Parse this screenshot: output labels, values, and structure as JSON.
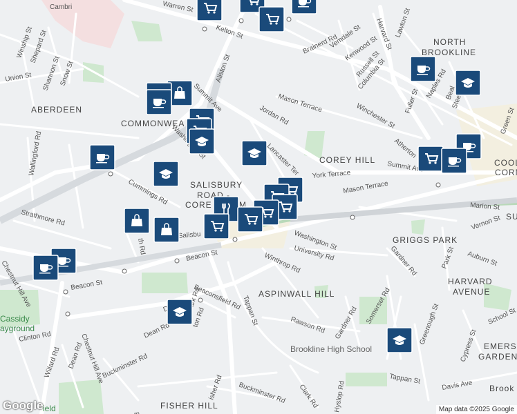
{
  "streets": [
    {
      "id": "cambridge",
      "text": "Cambri"
    },
    {
      "id": "warren",
      "text": "Warren St"
    },
    {
      "id": "kelton",
      "text": "Kelton St"
    },
    {
      "id": "brainerd",
      "text": "Brainerd Rd"
    },
    {
      "id": "vemdale",
      "text": "Vemdale St"
    },
    {
      "id": "kenwood",
      "text": "Kenwood St"
    },
    {
      "id": "harvard",
      "text": "Harvard St"
    },
    {
      "id": "lawton",
      "text": "Lawton St"
    },
    {
      "id": "russell",
      "text": "Russell St"
    },
    {
      "id": "columbia",
      "text": "Columbia St"
    },
    {
      "id": "winship",
      "text": "Winship St"
    },
    {
      "id": "shepard",
      "text": "Shepard St"
    },
    {
      "id": "union",
      "text": "Union St"
    },
    {
      "id": "shannon",
      "text": "Shannon St"
    },
    {
      "id": "snow",
      "text": "Snow St"
    },
    {
      "id": "allston",
      "text": "Allston St"
    },
    {
      "id": "summit1",
      "text": "Summit Ave"
    },
    {
      "id": "mason1",
      "text": "Mason Terrace"
    },
    {
      "id": "jordan",
      "text": "Jordan Rd"
    },
    {
      "id": "winchester",
      "text": "Winchester St"
    },
    {
      "id": "fuller",
      "text": "Fuller St"
    },
    {
      "id": "naples",
      "text": "Naples Rd"
    },
    {
      "id": "beals",
      "text": "Beal"
    },
    {
      "id": "steel",
      "text": "Stee"
    },
    {
      "id": "green",
      "text": "Green St"
    },
    {
      "id": "atherton",
      "text": "Atherton"
    },
    {
      "id": "washington1",
      "text": "Washington St"
    },
    {
      "id": "lancaster",
      "text": "Lancaster Ter"
    },
    {
      "id": "york",
      "text": "York Terrace"
    },
    {
      "id": "mason2",
      "text": "Mason Terrace"
    },
    {
      "id": "summit2",
      "text": "Summit Ave"
    },
    {
      "id": "wallingford",
      "text": "Wallingford Rd"
    },
    {
      "id": "cummings",
      "text": "Cummings Rd"
    },
    {
      "id": "kilsyth",
      "text": "th Rd"
    },
    {
      "id": "strathmore",
      "text": "Strathmore Rd"
    },
    {
      "id": "salisbury",
      "text": "Salisbu"
    },
    {
      "id": "washington2",
      "text": "Washington St"
    },
    {
      "id": "marion",
      "text": "Marion St"
    },
    {
      "id": "vernon",
      "text": "Vernon St"
    },
    {
      "id": "beacon1",
      "text": "Beacon St"
    },
    {
      "id": "beacon2",
      "text": "Beacon St"
    },
    {
      "id": "university",
      "text": "University Rd"
    },
    {
      "id": "winthrop",
      "text": "Winthrop Rd"
    },
    {
      "id": "gardner1",
      "text": "Gardner Rd"
    },
    {
      "id": "park",
      "text": "Park St"
    },
    {
      "id": "auburn",
      "text": "Auburn St"
    },
    {
      "id": "chestnut1",
      "text": "Chestnut Hill Ave"
    },
    {
      "id": "beaconsfield",
      "text": "Beaconsfield Rd"
    },
    {
      "id": "tappan1",
      "text": "Tappan St"
    },
    {
      "id": "rawson",
      "text": "Rawson Rd"
    },
    {
      "id": "gardner2",
      "text": "Gardner Rd"
    },
    {
      "id": "somerset",
      "text": "Somerset Rd"
    },
    {
      "id": "greenough",
      "text": "Greenough St"
    },
    {
      "id": "cypress",
      "text": "Cypress St"
    },
    {
      "id": "school",
      "text": "School St"
    },
    {
      "id": "clinton",
      "text": "Clinton Rd"
    },
    {
      "id": "chestnut2",
      "text": "Chestnut Hill Ave"
    },
    {
      "id": "dean1",
      "text": "Dean Rd"
    },
    {
      "id": "clark1",
      "text": "lark Rd"
    },
    {
      "id": "dean2",
      "text": "Dean"
    },
    {
      "id": "ton",
      "text": "ton Rd"
    },
    {
      "id": "willard",
      "text": "Willard Rd"
    },
    {
      "id": "deanrd",
      "text": "Dean Rd"
    },
    {
      "id": "buckminster1",
      "text": "Buckminster Rd"
    },
    {
      "id": "fisherrd",
      "text": "isher Rd"
    },
    {
      "id": "buckminster2",
      "text": "Buckminster Rd"
    },
    {
      "id": "clark2",
      "text": "Clark Rd"
    },
    {
      "id": "tappan2",
      "text": "Tappan St"
    },
    {
      "id": "davis",
      "text": "Davis Ave"
    },
    {
      "id": "hyslop",
      "text": "Hyslop Rd"
    },
    {
      "id": "rd",
      "text": "Rd"
    }
  ],
  "areas": [
    {
      "id": "north-brookline-1",
      "text": "NORTH"
    },
    {
      "id": "north-brookline-2",
      "text": "BROOKLINE"
    },
    {
      "id": "aberdeen",
      "text": "ABERDEEN"
    },
    {
      "id": "commonwealth",
      "text": "COMMONWEA"
    },
    {
      "id": "corey-hill",
      "text": "COREY HILL"
    },
    {
      "id": "salisbury-1",
      "text": "SALISBURY"
    },
    {
      "id": "salisbury-2",
      "text": "ROAD -"
    },
    {
      "id": "salisbury-3",
      "text": "CORE"
    },
    {
      "id": "salisbury-4",
      "text": "M"
    },
    {
      "id": "griggs",
      "text": "GRIGGS PARK"
    },
    {
      "id": "harvard-1",
      "text": "HARVARD"
    },
    {
      "id": "harvard-2",
      "text": "AVENUE"
    },
    {
      "id": "aspinwall",
      "text": "ASPINWALL HILL"
    },
    {
      "id": "fisher",
      "text": "FISHER HILL"
    },
    {
      "id": "emerson-1",
      "text": "EMERS"
    },
    {
      "id": "emerson-2",
      "text": "GARDEN"
    },
    {
      "id": "coolidge-1",
      "text": "COOLI"
    },
    {
      "id": "coolidge-2",
      "text": "CORN"
    },
    {
      "id": "su",
      "text": "SU"
    },
    {
      "id": "brookline-edge",
      "text": "Brook"
    }
  ],
  "pois": [
    {
      "id": "brookline-high",
      "text": "Brookline High School"
    },
    {
      "id": "cassidy-1",
      "text": "Cassidy"
    },
    {
      "id": "cassidy-2",
      "text": "ayground"
    },
    {
      "id": "field",
      "text": "ield"
    }
  ],
  "markers": [
    {
      "type": "grocery",
      "icon": "cart-icon"
    },
    {
      "type": "cafe",
      "icon": "cup-icon"
    },
    {
      "type": "shopping",
      "icon": "bag-icon"
    },
    {
      "type": "school",
      "icon": "mortarboard-icon"
    },
    {
      "type": "restaurant",
      "icon": "fork-knife-icon"
    }
  ],
  "google_logo": "Google",
  "attribution": "Map data ©2025 Google"
}
